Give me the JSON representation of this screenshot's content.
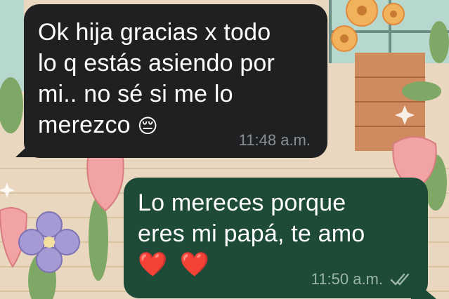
{
  "conversation": {
    "incoming": {
      "text": "Ok hija gracias x todo\nlo q estás asiendo por\nmi.. no sé si me lo\nmerezco",
      "emoji": "😔",
      "time": "11:48 a.m."
    },
    "outgoing": {
      "text": "Lo mereces porque\neres mi papá, te amo",
      "emoji": "❤️ ❤️",
      "time": "11:50 a.m.",
      "status_icon": "double-check-icon"
    }
  },
  "colors": {
    "incoming_bubble": "#1f2022",
    "outgoing_bubble": "#1e4a38",
    "wallpaper": "#e8d9c2"
  }
}
